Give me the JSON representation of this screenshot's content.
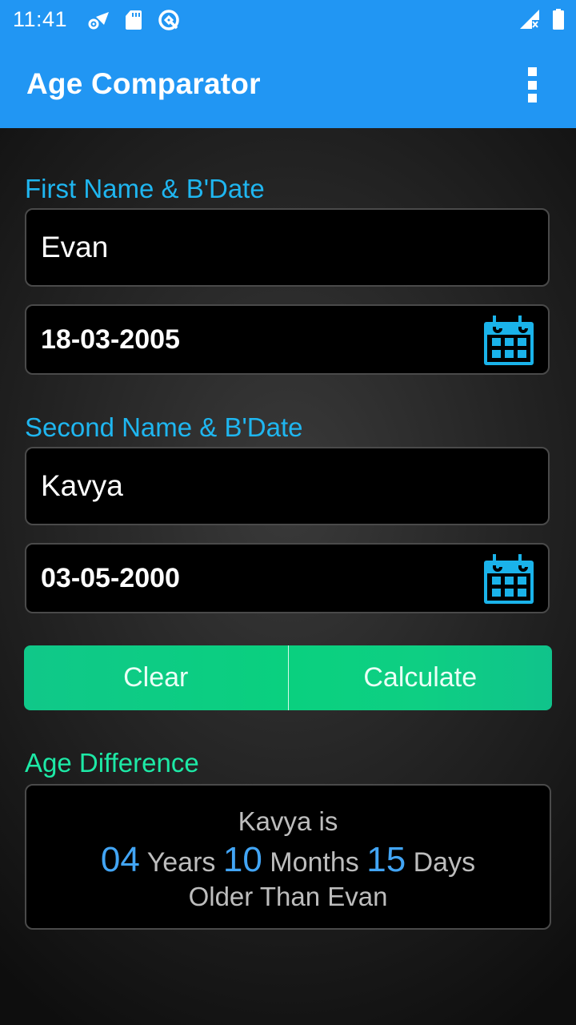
{
  "status_bar": {
    "time": "11:41",
    "left_icons": [
      "settings-wifi-icon",
      "sd-card-icon",
      "q-circle-icon"
    ],
    "right_icons": [
      "no-signal-icon",
      "battery-icon"
    ]
  },
  "app_bar": {
    "title": "Age Comparator",
    "menu_icon": "overflow-menu-icon"
  },
  "first_person": {
    "section_label": "First Name & B'Date",
    "name_value": "Evan",
    "birthdate_value": "18-03-2005",
    "calendar_icon": "calendar-icon"
  },
  "second_person": {
    "section_label": "Second Name & B'Date",
    "name_value": "Kavya",
    "birthdate_value": "03-05-2000",
    "calendar_icon": "calendar-icon"
  },
  "buttons": {
    "clear_label": "Clear",
    "calculate_label": "Calculate"
  },
  "result": {
    "section_label": "Age Difference",
    "line1": "Kavya is",
    "years_value": "04",
    "years_label": "Years",
    "months_value": "10",
    "months_label": "Months",
    "days_value": "15",
    "days_label": "Days",
    "line3": "Older Than Evan"
  },
  "colors": {
    "primary": "#2196F3",
    "label_blue": "#1FB6F0",
    "label_green": "#1DE9A6",
    "button_green": "#0AD07F",
    "number_blue": "#42A5F5"
  }
}
